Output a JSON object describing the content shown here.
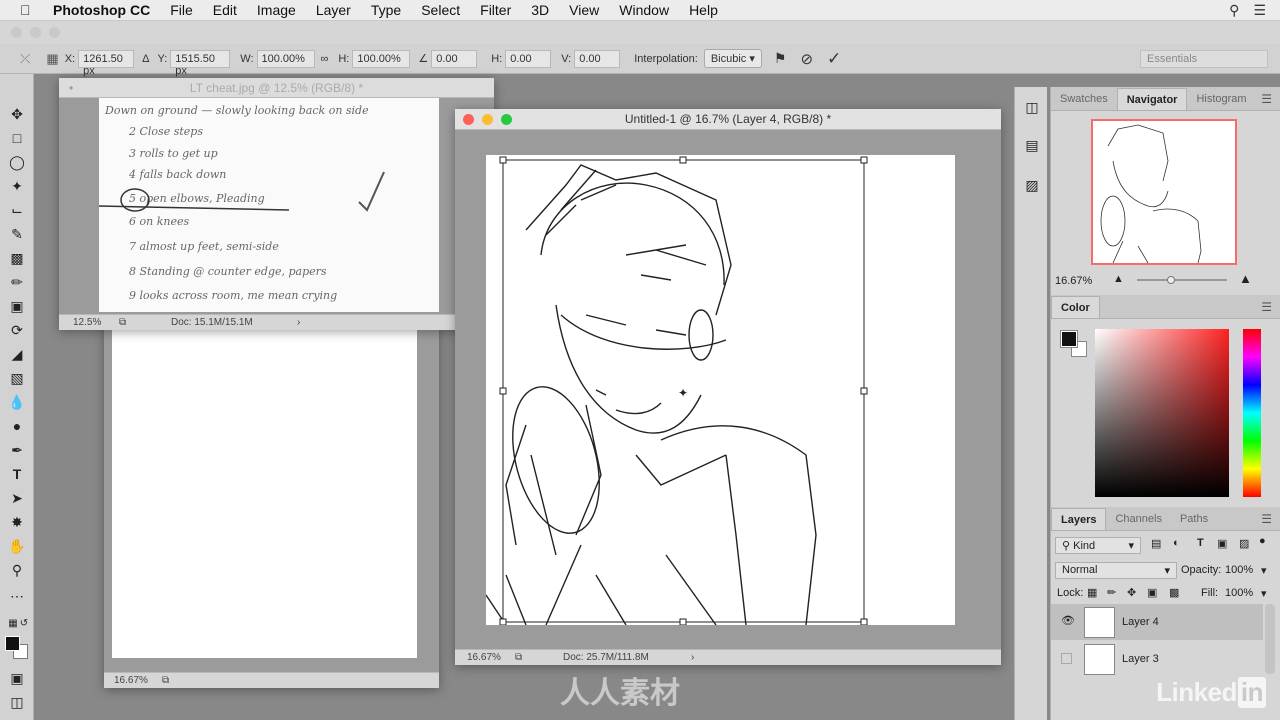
{
  "menubar": {
    "app_name": "Photoshop CC",
    "items": [
      "File",
      "Edit",
      "Image",
      "Layer",
      "Type",
      "Select",
      "Filter",
      "3D",
      "View",
      "Window",
      "Help"
    ]
  },
  "options": {
    "x_label": "X:",
    "x_value": "1261.50 px",
    "y_label": "Y:",
    "y_value": "1515.50 px",
    "w_label": "W:",
    "w_value": "100.00%",
    "h_label": "H:",
    "h_value": "100.00%",
    "angle_value": "0.00",
    "hskew_label": "H:",
    "hskew_value": "0.00",
    "vskew_label": "V:",
    "vskew_value": "0.00",
    "interp_label": "Interpolation:",
    "interp_value": "Bicubic",
    "workspace": "Essentials"
  },
  "doc_cheat": {
    "title": "LT cheat.jpg @ 12.5% (RGB/8) *",
    "zoom": "12.5%",
    "doc_info": "Doc: 15.1M/15.1M",
    "notes": [
      "Down on ground — slowly looking back on side",
      "2 Close steps",
      "3 rolls to get up",
      "4 falls back down",
      "5 open elbows, Pleading",
      "6 on knees",
      "7 almost up feet, semi-side",
      "8 Standing @ counter edge, papers",
      "9 looks across room, me mean crying"
    ]
  },
  "doc_back": {
    "zoom": "16.67%"
  },
  "doc_main": {
    "title": "Untitled-1 @ 16.7% (Layer 4, RGB/8) *",
    "zoom": "16.67%",
    "doc_info": "Doc: 25.7M/111.8M"
  },
  "navigator": {
    "tabs": [
      "Swatches",
      "Navigator",
      "Histogram"
    ],
    "active_tab": "Navigator",
    "zoom": "16.67%",
    "slider_fraction": 0.35
  },
  "color": {
    "tab": "Color",
    "fg": "#111111",
    "bg": "#ffffff"
  },
  "layers": {
    "tabs": [
      "Layers",
      "Channels",
      "Paths"
    ],
    "active_tab": "Layers",
    "filter": "Kind",
    "blend_mode": "Normal",
    "opacity_label": "Opacity:",
    "opacity": "100%",
    "lock_label": "Lock:",
    "fill_label": "Fill:",
    "fill": "100%",
    "items": [
      {
        "name": "Layer 4",
        "visible": true,
        "selected": true
      },
      {
        "name": "Layer 3",
        "visible": false,
        "selected": false
      }
    ]
  },
  "watermark": {
    "brand_text": "人人素材"
  },
  "linkedin": {
    "text": "Linked",
    "in": "in"
  },
  "colors": {
    "accent_red": "#ff5f57",
    "accent_yellow": "#febc2e",
    "accent_green": "#28c840"
  }
}
